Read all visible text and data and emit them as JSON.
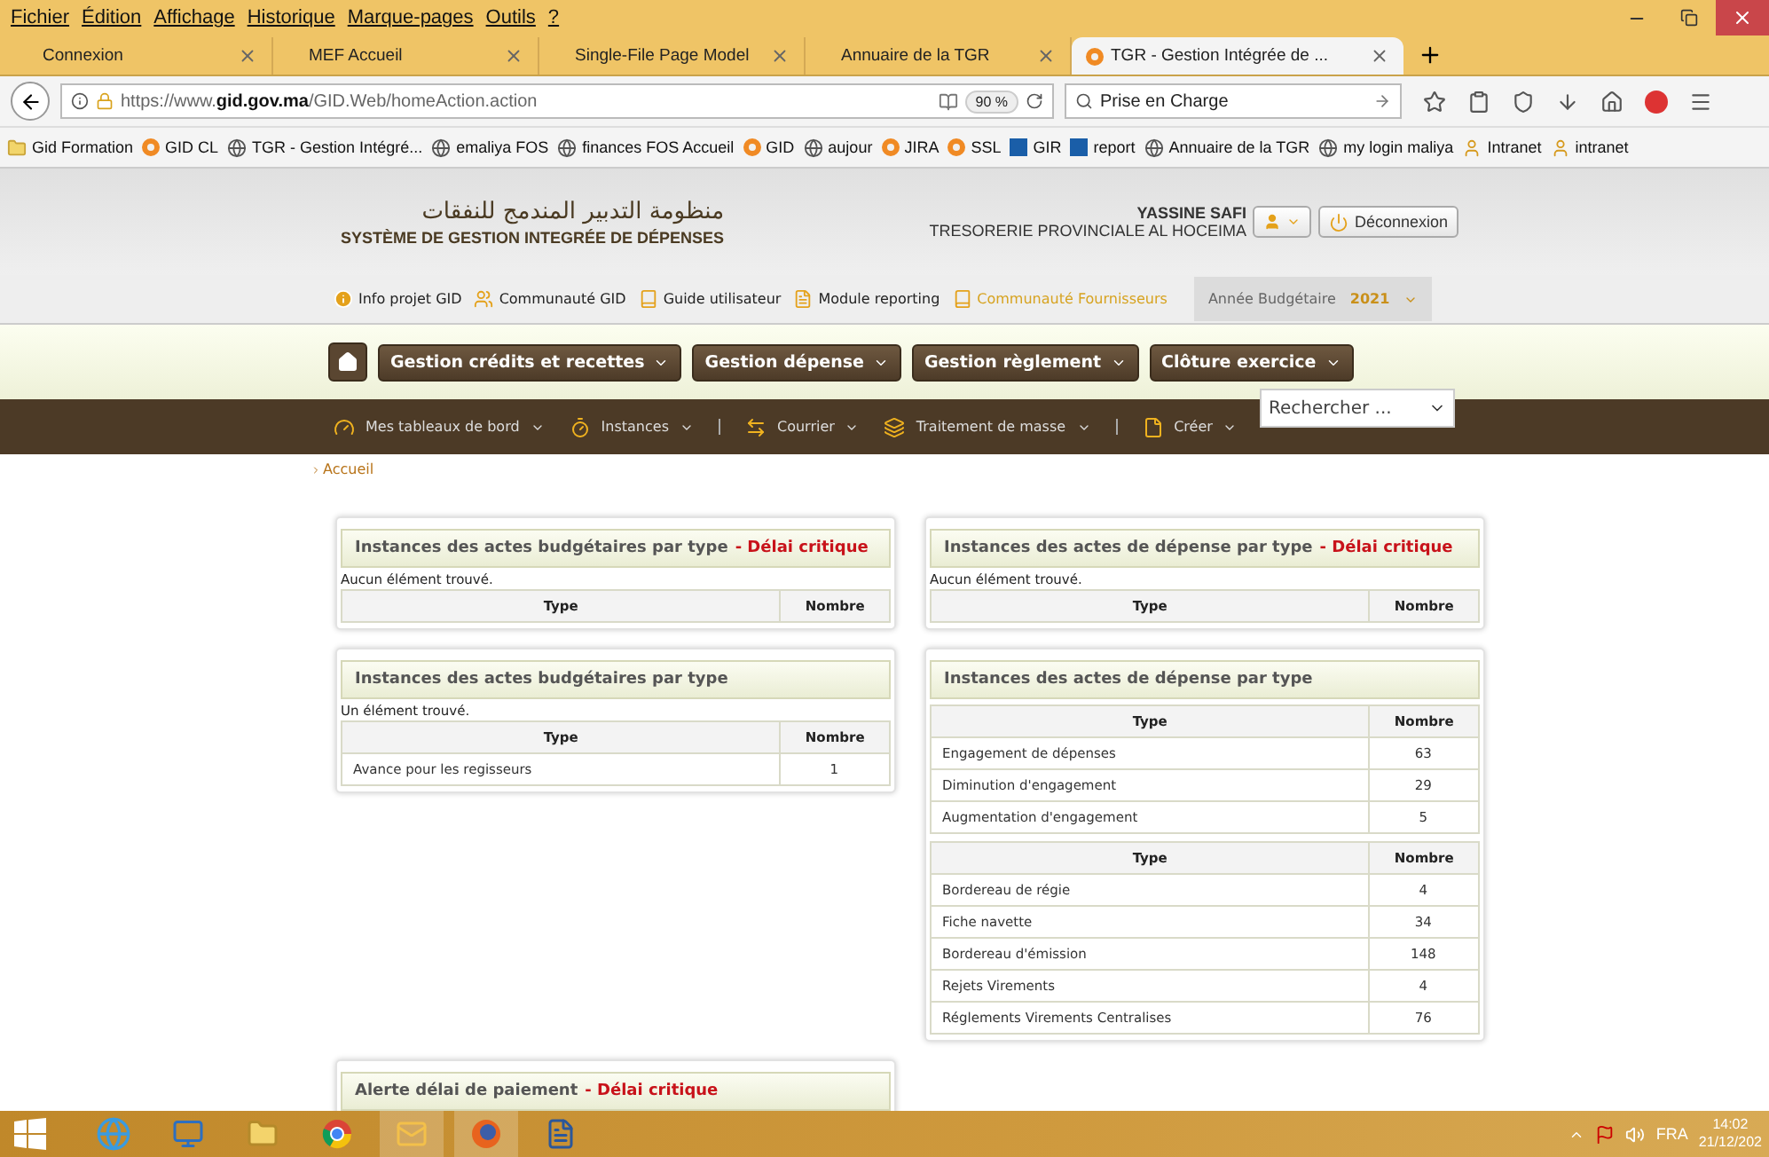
{
  "menu_bar": [
    "Fichier",
    "Édition",
    "Affichage",
    "Historique",
    "Marque-pages",
    "Outils",
    "?"
  ],
  "tabs": [
    {
      "title": "Connexion",
      "selected": false,
      "favicon": false
    },
    {
      "title": "MEF Accueil",
      "selected": false,
      "favicon": false
    },
    {
      "title": "Single-File Page Model",
      "selected": false,
      "favicon": false
    },
    {
      "title": "Annuaire de la TGR",
      "selected": false,
      "favicon": false
    },
    {
      "title": "TGR - Gestion Intégrée de ...",
      "selected": true,
      "favicon": true
    }
  ],
  "address_bar": {
    "url": "https://www.**gid.gov.ma**/GID.Web/homeAction.action",
    "zoom": "90 %",
    "search": "Prise en Charge"
  },
  "bookmarks": [
    {
      "label": "Gid Formation",
      "kind": "folder"
    },
    {
      "label": "GID CL",
      "kind": "site"
    },
    {
      "label": "TGR - Gestion Intégré...",
      "kind": "globe"
    },
    {
      "label": "emaliya FOS",
      "kind": "globe"
    },
    {
      "label": "finances FOS Accueil",
      "kind": "globe"
    },
    {
      "label": "GID",
      "kind": "site"
    },
    {
      "label": "aujour",
      "kind": "globe"
    },
    {
      "label": "JIRA",
      "kind": "site"
    },
    {
      "label": "SSL",
      "kind": "site"
    },
    {
      "label": "GIR",
      "kind": "ibm"
    },
    {
      "label": "report",
      "kind": "ibm"
    },
    {
      "label": "Annuaire de la TGR",
      "kind": "globe"
    },
    {
      "label": "my login maliya",
      "kind": "globe"
    },
    {
      "label": "Intranet",
      "kind": "person"
    },
    {
      "label": "intranet",
      "kind": "person"
    }
  ],
  "header": {
    "title_ar": "منظومة التدبير المندمج للنفقات",
    "title_fr": "SYSTÈME DE GESTION INTEGRÉE DE DÉPENSES",
    "user": "YASSINE SAFI",
    "org": "TRESORERIE PROVINCIALE AL HOCEIMA",
    "logout": "Déconnexion"
  },
  "links": [
    {
      "label": "Info projet GID",
      "kind": "info",
      "highlighted": false
    },
    {
      "label": "Communauté GID",
      "kind": "users",
      "highlighted": false
    },
    {
      "label": "Guide utilisateur",
      "kind": "book",
      "highlighted": false
    },
    {
      "label": "Module reporting",
      "kind": "report",
      "highlighted": false
    },
    {
      "label": "Communauté Fournisseurs",
      "kind": "book",
      "highlighted": true
    }
  ],
  "year": {
    "label": "Année Budgétaire",
    "value": "2021"
  },
  "main_menu": [
    "Gestion crédits et recettes",
    "Gestion dépense",
    "Gestion règlement",
    "Clôture exercice"
  ],
  "sub_nav": [
    {
      "label": "Mes tableaux de bord",
      "kind": "gauge",
      "separator": false
    },
    {
      "label": "Instances",
      "kind": "timer",
      "separator": false
    },
    {
      "label": "Courrier",
      "kind": "arrows",
      "separator": true
    },
    {
      "label": "Traitement de masse",
      "kind": "layers",
      "separator": false
    },
    {
      "label": "Créer",
      "kind": "file",
      "separator": true
    }
  ],
  "search": {
    "value": "Rechercher ..."
  },
  "breadcrumb": "Accueil",
  "columns": [
    [
      {
        "title": "Instances des actes budgétaires par type",
        "alert": "- Délai critique",
        "message": "Aucun élément trouvé.",
        "tables": [
          {
            "columns": [
              "Type",
              "Nombre"
            ]
          }
        ]
      },
      {
        "title": "Instances des actes budgétaires par type",
        "message": "Un élément trouvé.",
        "tables": [
          {
            "columns": [
              "Type",
              "Nombre"
            ],
            "rows": [
              [
                "Avance pour les regisseurs",
                "1"
              ]
            ]
          }
        ]
      }
    ],
    [
      {
        "title": "Instances des actes de dépense par type",
        "alert": "- Délai critique",
        "message": "Aucun élément trouvé.",
        "tables": [
          {
            "columns": [
              "Type",
              "Nombre"
            ]
          }
        ]
      },
      {
        "title": "Instances des actes de dépense par type",
        "tables": [
          {
            "columns": [
              "Type",
              "Nombre"
            ],
            "rows": [
              [
                "Engagement de dépenses",
                "63"
              ],
              [
                "Diminution d'engagement",
                "29"
              ],
              [
                "Augmentation d'engagement",
                "5"
              ]
            ]
          },
          {
            "columns": [
              "Type",
              "Nombre"
            ],
            "rows": [
              [
                "Bordereau de régie",
                "4"
              ],
              [
                "Fiche navette",
                "34"
              ],
              [
                "Bordereau d'émission",
                "148"
              ],
              [
                "Rejets Virements",
                "4"
              ],
              [
                "Réglements Virements Centralises",
                "76"
              ]
            ]
          }
        ]
      }
    ]
  ],
  "bottom_panels": [
    {
      "title": "Alerte délai de paiement",
      "alert": "- Délai critique"
    }
  ],
  "taskbar": {
    "apps": [
      {
        "kind": "ie",
        "selected": false
      },
      {
        "kind": "control",
        "selected": false
      },
      {
        "kind": "explorer",
        "selected": false
      },
      {
        "kind": "chrome",
        "selected": false
      },
      {
        "kind": "outlook",
        "selected": true
      },
      {
        "kind": "firefox",
        "selected": true
      },
      {
        "kind": "word",
        "selected": false
      }
    ],
    "language": "FRA",
    "time": "14:02",
    "date": "21/12/202"
  }
}
